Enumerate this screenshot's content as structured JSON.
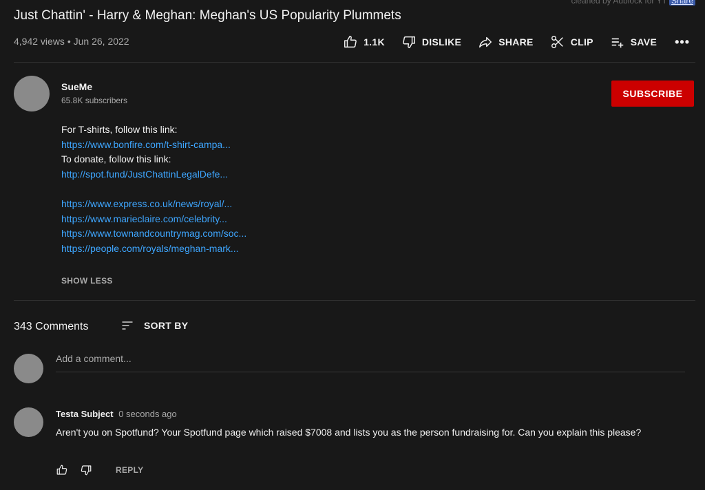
{
  "top_note": {
    "text": "cleaned by Adblock for YT",
    "chip": "Share"
  },
  "video": {
    "title": "Just Chattin' - Harry & Meghan: Meghan's US Popularity Plummets",
    "views": "4,942 views",
    "separator": "•",
    "date": "Jun 26, 2022"
  },
  "actions": {
    "like": {
      "label": "1.1K",
      "icon": "thumbs-up-icon"
    },
    "dislike": {
      "label": "DISLIKE",
      "icon": "thumbs-down-icon"
    },
    "share": {
      "label": "SHARE",
      "icon": "share-arrow-icon"
    },
    "clip": {
      "label": "CLIP",
      "icon": "scissors-icon"
    },
    "save": {
      "label": "SAVE",
      "icon": "playlist-add-icon"
    },
    "more": {
      "label": "•••",
      "icon": "more-icon"
    }
  },
  "channel": {
    "name": "SueMe",
    "subscribers": "65.8K subscribers",
    "subscribe_label": "SUBSCRIBE"
  },
  "description": {
    "lines": [
      {
        "type": "text",
        "text": "For T-shirts, follow this link:"
      },
      {
        "type": "link",
        "text": "https://www.bonfire.com/t-shirt-campa..."
      },
      {
        "type": "text",
        "text": "To donate, follow this link:"
      },
      {
        "type": "link",
        "text": "http://spot.fund/JustChattinLegalDefe..."
      },
      {
        "type": "blank",
        "text": ""
      },
      {
        "type": "link",
        "text": "https://www.express.co.uk/news/royal/..."
      },
      {
        "type": "link",
        "text": "https://www.marieclaire.com/celebrity..."
      },
      {
        "type": "link",
        "text": "https://www.townandcountrymag.com/soc..."
      },
      {
        "type": "link",
        "text": "https://people.com/royals/meghan-mark..."
      }
    ],
    "show_less": "SHOW LESS"
  },
  "comments": {
    "count": "343 Comments",
    "sort_by": "SORT BY",
    "add_placeholder": "Add a comment...",
    "items": [
      {
        "author": "Testa Subject",
        "time": "0 seconds ago",
        "body": "Aren't you on Spotfund? Your Spotfund page which raised $7008 and lists you as the person fundraising for. Can you explain this please?",
        "reply_label": "REPLY"
      }
    ]
  },
  "colors": {
    "background": "#181818",
    "link": "#3ea6ff",
    "subscribe": "#cc0000",
    "secondary_text": "#aaaaaa"
  }
}
